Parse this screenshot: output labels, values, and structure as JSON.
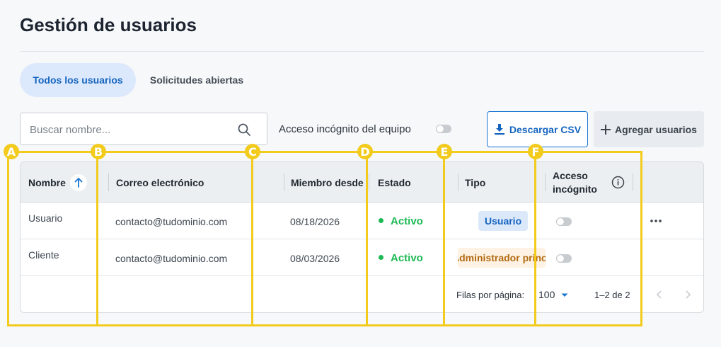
{
  "header": {
    "title": "Gestión de usuarios"
  },
  "tabs": [
    {
      "label": "Todos los usuarios",
      "active": true
    },
    {
      "label": "Solicitudes abiertas",
      "active": false
    }
  ],
  "toolbar": {
    "search_placeholder": "Buscar nombre...",
    "incognito_label": "Acceso incógnito del equipo",
    "incognito_on": false,
    "download_label": "Descargar CSV",
    "add_label": "Agregar usuarios"
  },
  "table": {
    "columns": {
      "name": "Nombre",
      "email": "Correo electrónico",
      "member_since": "Miembro desde",
      "status": "Estado",
      "type": "Tipo",
      "incognito_line1": "Acceso",
      "incognito_line2": "incógnito"
    },
    "rows": [
      {
        "name": "Usuario",
        "email": "contacto@tudominio.com",
        "member_since": "08/18/2026",
        "status": "Activo",
        "type": "Usuario",
        "incognito_on": false
      },
      {
        "name": "Cliente",
        "email": "contacto@tudominio.com",
        "member_since": "08/03/2026",
        "status": "Activo",
        "type": "Administrador principal",
        "incognito_on": false
      }
    ],
    "footer": {
      "rows_per_page_label": "Filas por página:",
      "rows_per_page": "100",
      "range": "1–2 de 2"
    }
  },
  "markers": [
    "A",
    "B",
    "C",
    "D",
    "E",
    "F"
  ],
  "colors": {
    "accent": "#1976d2",
    "active": "#1db954",
    "marker": "#f2cb1d",
    "admin_badge": "#b36b12"
  }
}
